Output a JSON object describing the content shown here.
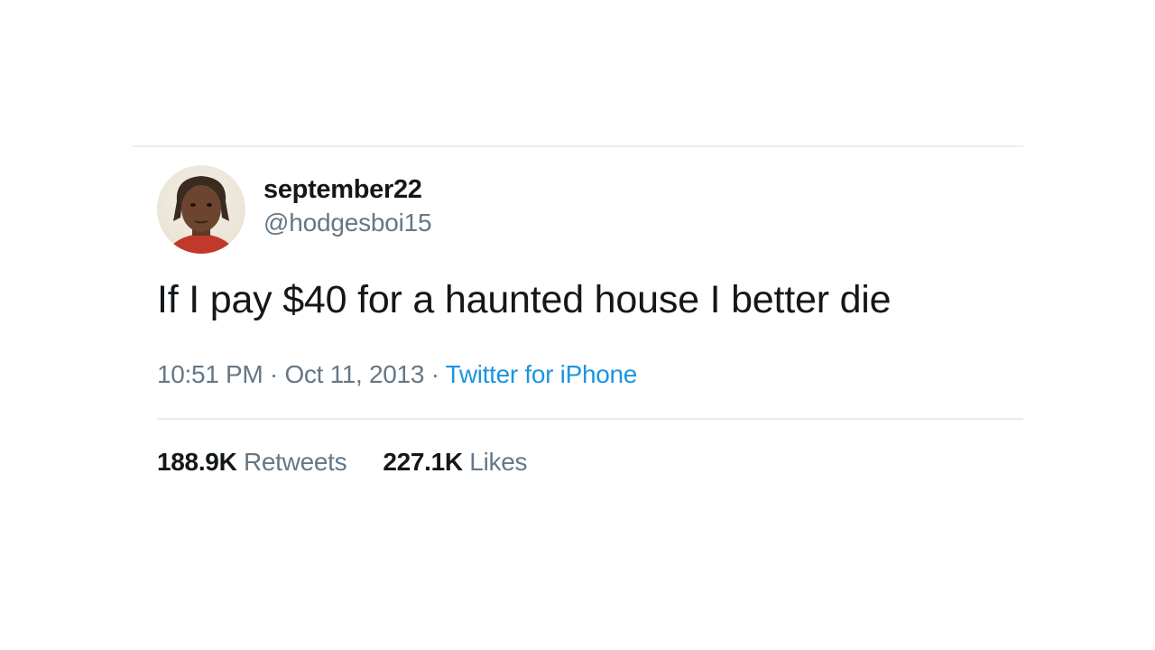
{
  "tweet": {
    "display_name": "september22",
    "handle": "@hodgesboi15",
    "avatar_icon": "user-avatar",
    "text": "If I pay $40 for a haunted house I better die",
    "time": "10:51 PM",
    "separator": " · ",
    "date": "Oct 11, 2013",
    "source": "Twitter for iPhone",
    "source_color": "#1b95e0"
  },
  "stats": {
    "retweets_count": "188.9K",
    "retweets_label": "Retweets",
    "likes_count": "227.1K",
    "likes_label": "Likes"
  }
}
